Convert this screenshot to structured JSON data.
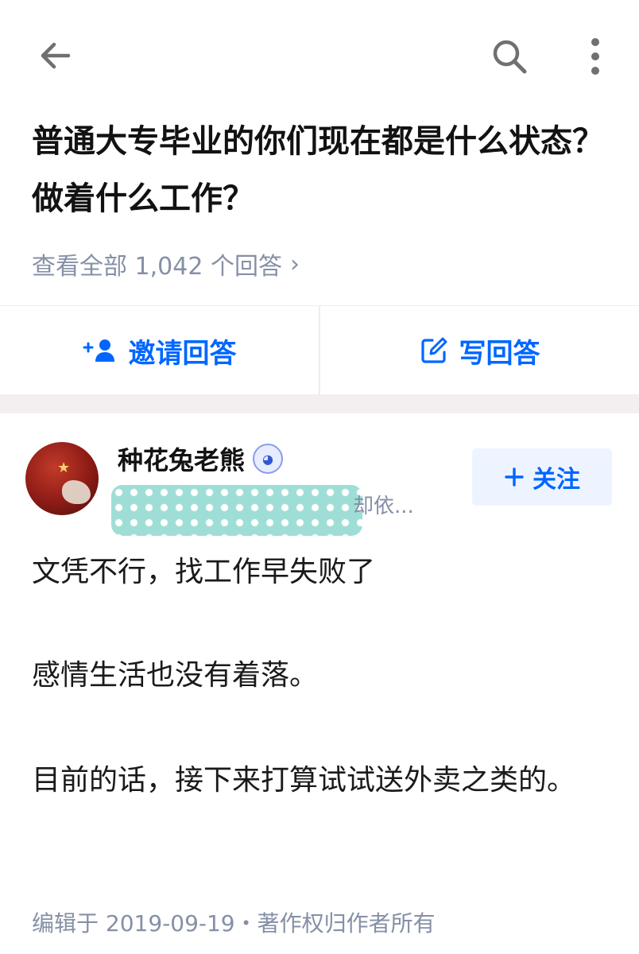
{
  "header": {
    "back_icon": "arrow-left-icon",
    "search_icon": "search-icon",
    "more_icon": "more-vertical-icon"
  },
  "question": {
    "title": "普通大专毕业的你们现在都是什么状态？做着什么工作？",
    "view_all": "查看全部 1,042 个回答",
    "answer_count": 1042
  },
  "actions": {
    "invite_label": "邀请回答",
    "write_label": "写回答",
    "accent": "#0066ff"
  },
  "author": {
    "name": "种花兔老熊",
    "bio_tail": "却依...",
    "follow_label": "关注"
  },
  "answer": {
    "paragraphs": [
      "文凭不行，找工作早失败了",
      "感情生活也没有着落。",
      "目前的话，接下来打算试试送外卖之类的。"
    ]
  },
  "footer": {
    "meta": "编辑于 2019-09-19・著作权归作者所有"
  }
}
